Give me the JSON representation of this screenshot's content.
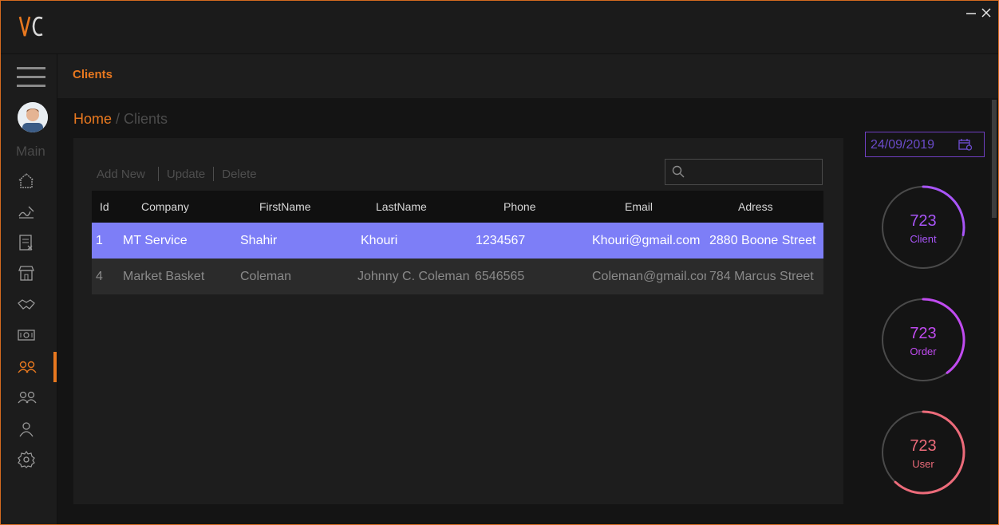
{
  "app": {
    "logo_text": "VC"
  },
  "window": {
    "minimize_glyph": "—",
    "close_glyph": "✕"
  },
  "sidebar": {
    "section_label": "Main",
    "items": [
      {
        "icon": "home-icon"
      },
      {
        "icon": "sign-icon"
      },
      {
        "icon": "invoice-icon"
      },
      {
        "icon": "store-icon"
      },
      {
        "icon": "handshake-icon"
      },
      {
        "icon": "money-icon"
      },
      {
        "icon": "clients-icon",
        "active": true
      },
      {
        "icon": "users-group-icon"
      },
      {
        "icon": "user-icon"
      },
      {
        "icon": "gear-icon"
      }
    ]
  },
  "header": {
    "title": "Clients"
  },
  "breadcrumb": {
    "home": "Home",
    "separator": " / ",
    "current": "Clients"
  },
  "toolbar": {
    "add_label": "Add New",
    "update_label": "Update",
    "delete_label": "Delete"
  },
  "search": {
    "placeholder": ""
  },
  "table": {
    "columns": [
      "Id",
      "Company",
      "FirstName",
      "LastName",
      "Phone",
      "Email",
      "Adress"
    ],
    "rows": [
      [
        "1",
        "MT Service",
        "Shahir",
        "Khouri",
        "1234567",
        "Khouri@gmail.com",
        "2880 Boone Street"
      ],
      [
        "4",
        "Market Basket",
        "Coleman",
        "Johnny C. Coleman",
        "6546565",
        "Coleman@gmail.com",
        "784 Marcus Street"
      ]
    ],
    "selected_row": 0
  },
  "date": {
    "value": "24/09/2019"
  },
  "stats": [
    {
      "value": "723",
      "label": "Client",
      "color": "#a855f7",
      "progress": 0.28
    },
    {
      "value": "723",
      "label": "Order",
      "color": "#c04bf0",
      "progress": 0.4
    },
    {
      "value": "723",
      "label": "User",
      "color": "#ec6b7a",
      "progress": 0.62
    }
  ],
  "colors": {
    "accent": "#e8781f",
    "selected_row": "#7d7ef7",
    "date_border": "#6f3fc2"
  }
}
